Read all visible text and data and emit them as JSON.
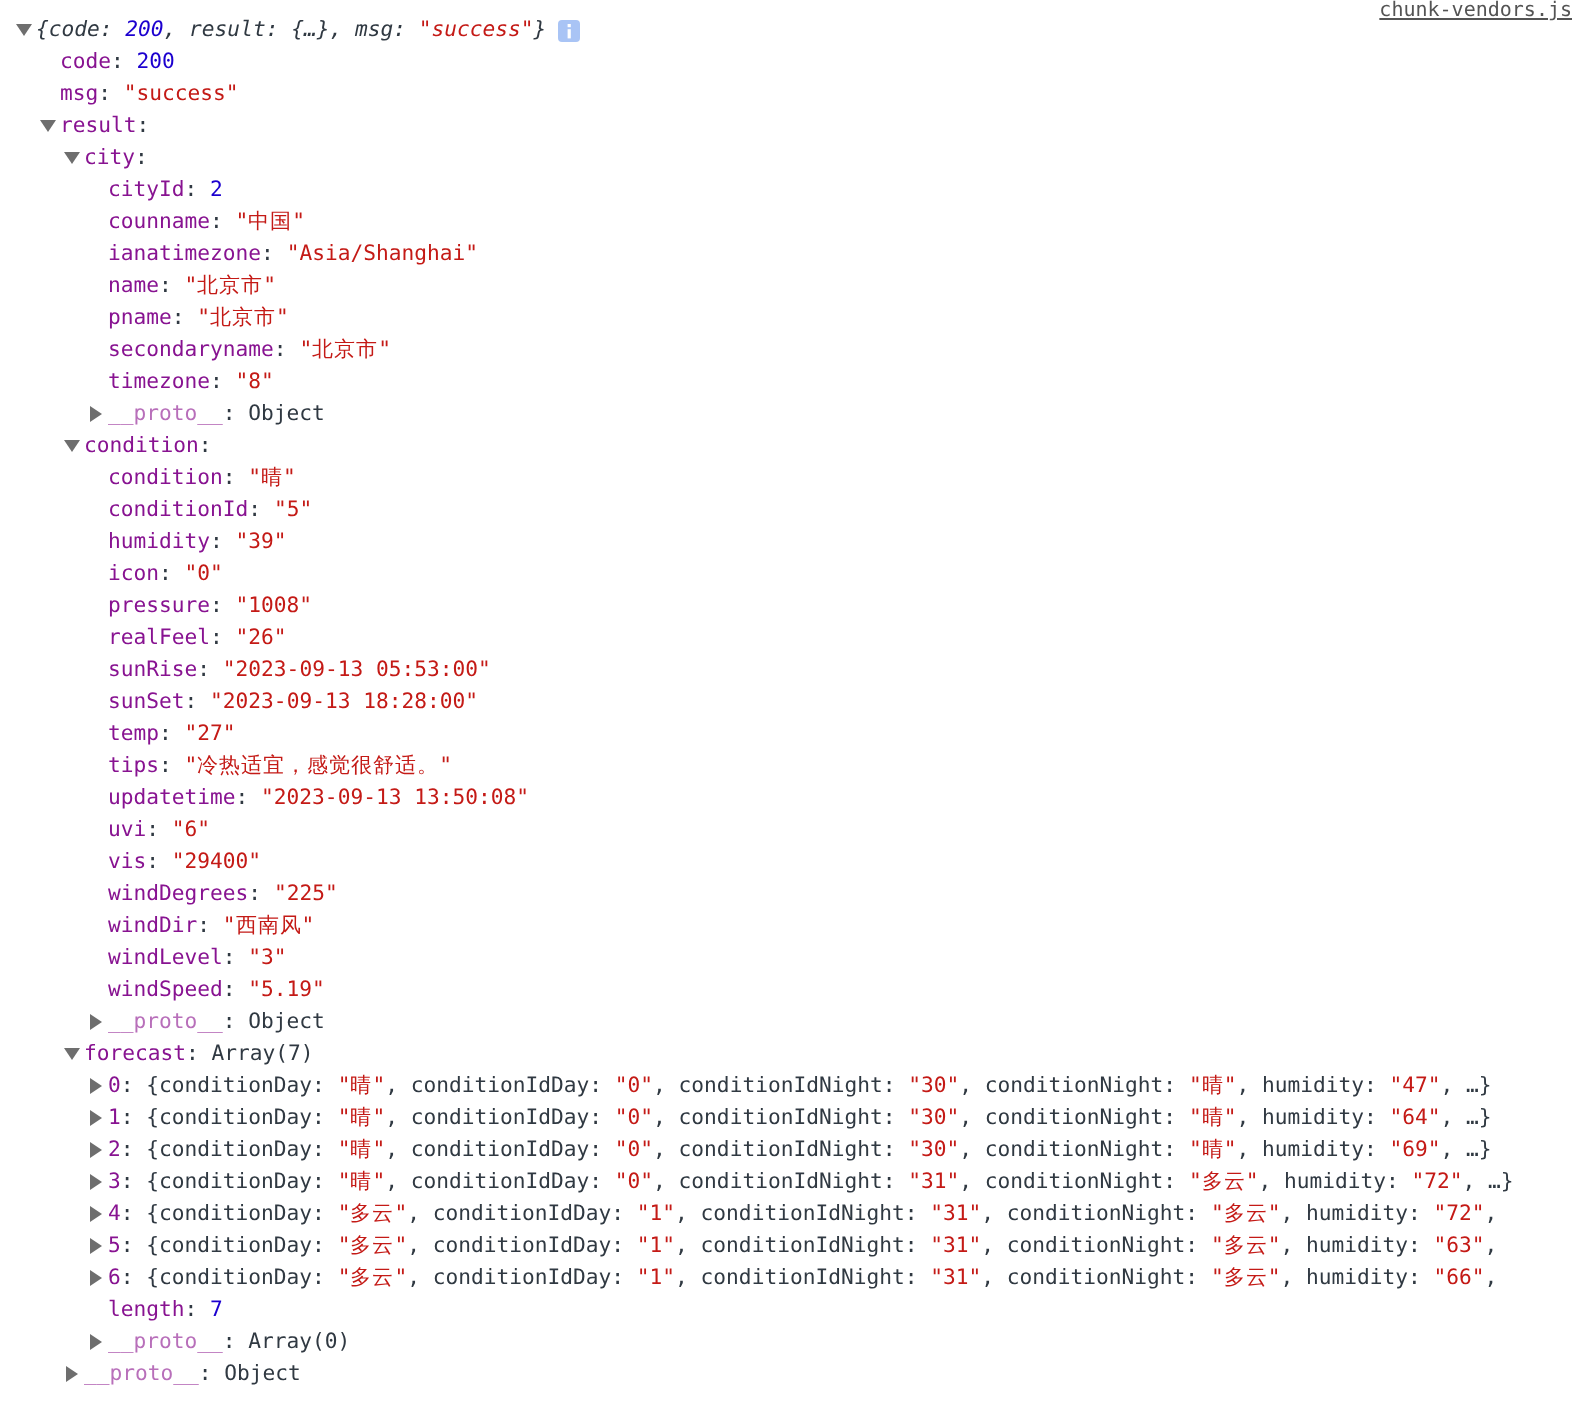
{
  "source_link": "chunk-vendors.js",
  "tree": {
    "kind": "summary",
    "expanded": true,
    "segments": [
      {
        "text": "{code: ",
        "kind": "plain"
      },
      {
        "text": "200",
        "kind": "number"
      },
      {
        "text": ", result: {…}, msg: ",
        "kind": "plain"
      },
      {
        "text": "\"success\"",
        "kind": "string"
      },
      {
        "text": "}",
        "kind": "plain"
      }
    ],
    "children": [
      {
        "kind": "property",
        "segments": [
          {
            "text": "code",
            "kind": "key"
          },
          {
            "text": ": ",
            "kind": "plain"
          },
          {
            "text": "200",
            "kind": "number"
          }
        ]
      },
      {
        "kind": "property",
        "segments": [
          {
            "text": "msg",
            "kind": "key"
          },
          {
            "text": ": ",
            "kind": "plain"
          },
          {
            "text": "\"success\"",
            "kind": "string"
          }
        ]
      },
      {
        "kind": "property",
        "expanded": true,
        "segments": [
          {
            "text": "result",
            "kind": "key"
          },
          {
            "text": ":",
            "kind": "plain"
          }
        ],
        "children": [
          {
            "kind": "property",
            "expanded": true,
            "segments": [
              {
                "text": "city",
                "kind": "key"
              },
              {
                "text": ":",
                "kind": "plain"
              }
            ],
            "children": [
              {
                "kind": "property",
                "segments": [
                  {
                    "text": "cityId",
                    "kind": "key"
                  },
                  {
                    "text": ": ",
                    "kind": "plain"
                  },
                  {
                    "text": "2",
                    "kind": "number"
                  }
                ]
              },
              {
                "kind": "property",
                "segments": [
                  {
                    "text": "counname",
                    "kind": "key"
                  },
                  {
                    "text": ": ",
                    "kind": "plain"
                  },
                  {
                    "text": "\"中国\"",
                    "kind": "string"
                  }
                ]
              },
              {
                "kind": "property",
                "segments": [
                  {
                    "text": "ianatimezone",
                    "kind": "key"
                  },
                  {
                    "text": ": ",
                    "kind": "plain"
                  },
                  {
                    "text": "\"Asia/Shanghai\"",
                    "kind": "string"
                  }
                ]
              },
              {
                "kind": "property",
                "segments": [
                  {
                    "text": "name",
                    "kind": "key"
                  },
                  {
                    "text": ": ",
                    "kind": "plain"
                  },
                  {
                    "text": "\"北京市\"",
                    "kind": "string"
                  }
                ]
              },
              {
                "kind": "property",
                "segments": [
                  {
                    "text": "pname",
                    "kind": "key"
                  },
                  {
                    "text": ": ",
                    "kind": "plain"
                  },
                  {
                    "text": "\"北京市\"",
                    "kind": "string"
                  }
                ]
              },
              {
                "kind": "property",
                "segments": [
                  {
                    "text": "secondaryname",
                    "kind": "key"
                  },
                  {
                    "text": ": ",
                    "kind": "plain"
                  },
                  {
                    "text": "\"北京市\"",
                    "kind": "string"
                  }
                ]
              },
              {
                "kind": "property",
                "segments": [
                  {
                    "text": "timezone",
                    "kind": "key"
                  },
                  {
                    "text": ": ",
                    "kind": "plain"
                  },
                  {
                    "text": "\"8\"",
                    "kind": "string"
                  }
                ]
              },
              {
                "kind": "property",
                "expanded": false,
                "segments": [
                  {
                    "text": "__proto__",
                    "kind": "proto"
                  },
                  {
                    "text": ": Object",
                    "kind": "plain"
                  }
                ]
              }
            ]
          },
          {
            "kind": "property",
            "expanded": true,
            "segments": [
              {
                "text": "condition",
                "kind": "key"
              },
              {
                "text": ":",
                "kind": "plain"
              }
            ],
            "children": [
              {
                "kind": "property",
                "segments": [
                  {
                    "text": "condition",
                    "kind": "key"
                  },
                  {
                    "text": ": ",
                    "kind": "plain"
                  },
                  {
                    "text": "\"晴\"",
                    "kind": "string"
                  }
                ]
              },
              {
                "kind": "property",
                "segments": [
                  {
                    "text": "conditionId",
                    "kind": "key"
                  },
                  {
                    "text": ": ",
                    "kind": "plain"
                  },
                  {
                    "text": "\"5\"",
                    "kind": "string"
                  }
                ]
              },
              {
                "kind": "property",
                "segments": [
                  {
                    "text": "humidity",
                    "kind": "key"
                  },
                  {
                    "text": ": ",
                    "kind": "plain"
                  },
                  {
                    "text": "\"39\"",
                    "kind": "string"
                  }
                ]
              },
              {
                "kind": "property",
                "segments": [
                  {
                    "text": "icon",
                    "kind": "key"
                  },
                  {
                    "text": ": ",
                    "kind": "plain"
                  },
                  {
                    "text": "\"0\"",
                    "kind": "string"
                  }
                ]
              },
              {
                "kind": "property",
                "segments": [
                  {
                    "text": "pressure",
                    "kind": "key"
                  },
                  {
                    "text": ": ",
                    "kind": "plain"
                  },
                  {
                    "text": "\"1008\"",
                    "kind": "string"
                  }
                ]
              },
              {
                "kind": "property",
                "segments": [
                  {
                    "text": "realFeel",
                    "kind": "key"
                  },
                  {
                    "text": ": ",
                    "kind": "plain"
                  },
                  {
                    "text": "\"26\"",
                    "kind": "string"
                  }
                ]
              },
              {
                "kind": "property",
                "segments": [
                  {
                    "text": "sunRise",
                    "kind": "key"
                  },
                  {
                    "text": ": ",
                    "kind": "plain"
                  },
                  {
                    "text": "\"2023-09-13 05:53:00\"",
                    "kind": "string"
                  }
                ]
              },
              {
                "kind": "property",
                "segments": [
                  {
                    "text": "sunSet",
                    "kind": "key"
                  },
                  {
                    "text": ": ",
                    "kind": "plain"
                  },
                  {
                    "text": "\"2023-09-13 18:28:00\"",
                    "kind": "string"
                  }
                ]
              },
              {
                "kind": "property",
                "segments": [
                  {
                    "text": "temp",
                    "kind": "key"
                  },
                  {
                    "text": ": ",
                    "kind": "plain"
                  },
                  {
                    "text": "\"27\"",
                    "kind": "string"
                  }
                ]
              },
              {
                "kind": "property",
                "segments": [
                  {
                    "text": "tips",
                    "kind": "key"
                  },
                  {
                    "text": ": ",
                    "kind": "plain"
                  },
                  {
                    "text": "\"冷热适宜，感觉很舒适。\"",
                    "kind": "string"
                  }
                ]
              },
              {
                "kind": "property",
                "segments": [
                  {
                    "text": "updatetime",
                    "kind": "key"
                  },
                  {
                    "text": ": ",
                    "kind": "plain"
                  },
                  {
                    "text": "\"2023-09-13 13:50:08\"",
                    "kind": "string"
                  }
                ]
              },
              {
                "kind": "property",
                "segments": [
                  {
                    "text": "uvi",
                    "kind": "key"
                  },
                  {
                    "text": ": ",
                    "kind": "plain"
                  },
                  {
                    "text": "\"6\"",
                    "kind": "string"
                  }
                ]
              },
              {
                "kind": "property",
                "segments": [
                  {
                    "text": "vis",
                    "kind": "key"
                  },
                  {
                    "text": ": ",
                    "kind": "plain"
                  },
                  {
                    "text": "\"29400\"",
                    "kind": "string"
                  }
                ]
              },
              {
                "kind": "property",
                "segments": [
                  {
                    "text": "windDegrees",
                    "kind": "key"
                  },
                  {
                    "text": ": ",
                    "kind": "plain"
                  },
                  {
                    "text": "\"225\"",
                    "kind": "string"
                  }
                ]
              },
              {
                "kind": "property",
                "segments": [
                  {
                    "text": "windDir",
                    "kind": "key"
                  },
                  {
                    "text": ": ",
                    "kind": "plain"
                  },
                  {
                    "text": "\"西南风\"",
                    "kind": "string"
                  }
                ]
              },
              {
                "kind": "property",
                "segments": [
                  {
                    "text": "windLevel",
                    "kind": "key"
                  },
                  {
                    "text": ": ",
                    "kind": "plain"
                  },
                  {
                    "text": "\"3\"",
                    "kind": "string"
                  }
                ]
              },
              {
                "kind": "property",
                "segments": [
                  {
                    "text": "windSpeed",
                    "kind": "key"
                  },
                  {
                    "text": ": ",
                    "kind": "plain"
                  },
                  {
                    "text": "\"5.19\"",
                    "kind": "string"
                  }
                ]
              },
              {
                "kind": "property",
                "expanded": false,
                "segments": [
                  {
                    "text": "__proto__",
                    "kind": "proto"
                  },
                  {
                    "text": ": Object",
                    "kind": "plain"
                  }
                ]
              }
            ]
          },
          {
            "kind": "property",
            "expanded": true,
            "segments": [
              {
                "text": "forecast",
                "kind": "key"
              },
              {
                "text": ": Array(7)",
                "kind": "plain"
              }
            ],
            "children": [
              {
                "kind": "property",
                "expanded": false,
                "segments": [
                  {
                    "text": "0",
                    "kind": "key"
                  },
                  {
                    "text": ": {conditionDay: ",
                    "kind": "plain"
                  },
                  {
                    "text": "\"晴\"",
                    "kind": "string"
                  },
                  {
                    "text": ", conditionIdDay: ",
                    "kind": "plain"
                  },
                  {
                    "text": "\"0\"",
                    "kind": "string"
                  },
                  {
                    "text": ", conditionIdNight: ",
                    "kind": "plain"
                  },
                  {
                    "text": "\"30\"",
                    "kind": "string"
                  },
                  {
                    "text": ", conditionNight: ",
                    "kind": "plain"
                  },
                  {
                    "text": "\"晴\"",
                    "kind": "string"
                  },
                  {
                    "text": ", humidity: ",
                    "kind": "plain"
                  },
                  {
                    "text": "\"47\"",
                    "kind": "string"
                  },
                  {
                    "text": ", …}",
                    "kind": "plain"
                  }
                ]
              },
              {
                "kind": "property",
                "expanded": false,
                "segments": [
                  {
                    "text": "1",
                    "kind": "key"
                  },
                  {
                    "text": ": {conditionDay: ",
                    "kind": "plain"
                  },
                  {
                    "text": "\"晴\"",
                    "kind": "string"
                  },
                  {
                    "text": ", conditionIdDay: ",
                    "kind": "plain"
                  },
                  {
                    "text": "\"0\"",
                    "kind": "string"
                  },
                  {
                    "text": ", conditionIdNight: ",
                    "kind": "plain"
                  },
                  {
                    "text": "\"30\"",
                    "kind": "string"
                  },
                  {
                    "text": ", conditionNight: ",
                    "kind": "plain"
                  },
                  {
                    "text": "\"晴\"",
                    "kind": "string"
                  },
                  {
                    "text": ", humidity: ",
                    "kind": "plain"
                  },
                  {
                    "text": "\"64\"",
                    "kind": "string"
                  },
                  {
                    "text": ", …}",
                    "kind": "plain"
                  }
                ]
              },
              {
                "kind": "property",
                "expanded": false,
                "segments": [
                  {
                    "text": "2",
                    "kind": "key"
                  },
                  {
                    "text": ": {conditionDay: ",
                    "kind": "plain"
                  },
                  {
                    "text": "\"晴\"",
                    "kind": "string"
                  },
                  {
                    "text": ", conditionIdDay: ",
                    "kind": "plain"
                  },
                  {
                    "text": "\"0\"",
                    "kind": "string"
                  },
                  {
                    "text": ", conditionIdNight: ",
                    "kind": "plain"
                  },
                  {
                    "text": "\"30\"",
                    "kind": "string"
                  },
                  {
                    "text": ", conditionNight: ",
                    "kind": "plain"
                  },
                  {
                    "text": "\"晴\"",
                    "kind": "string"
                  },
                  {
                    "text": ", humidity: ",
                    "kind": "plain"
                  },
                  {
                    "text": "\"69\"",
                    "kind": "string"
                  },
                  {
                    "text": ", …}",
                    "kind": "plain"
                  }
                ]
              },
              {
                "kind": "property",
                "expanded": false,
                "segments": [
                  {
                    "text": "3",
                    "kind": "key"
                  },
                  {
                    "text": ": {conditionDay: ",
                    "kind": "plain"
                  },
                  {
                    "text": "\"晴\"",
                    "kind": "string"
                  },
                  {
                    "text": ", conditionIdDay: ",
                    "kind": "plain"
                  },
                  {
                    "text": "\"0\"",
                    "kind": "string"
                  },
                  {
                    "text": ", conditionIdNight: ",
                    "kind": "plain"
                  },
                  {
                    "text": "\"31\"",
                    "kind": "string"
                  },
                  {
                    "text": ", conditionNight: ",
                    "kind": "plain"
                  },
                  {
                    "text": "\"多云\"",
                    "kind": "string"
                  },
                  {
                    "text": ", humidity: ",
                    "kind": "plain"
                  },
                  {
                    "text": "\"72\"",
                    "kind": "string"
                  },
                  {
                    "text": ", …}",
                    "kind": "plain"
                  }
                ]
              },
              {
                "kind": "property",
                "expanded": false,
                "segments": [
                  {
                    "text": "4",
                    "kind": "key"
                  },
                  {
                    "text": ": {conditionDay: ",
                    "kind": "plain"
                  },
                  {
                    "text": "\"多云\"",
                    "kind": "string"
                  },
                  {
                    "text": ", conditionIdDay: ",
                    "kind": "plain"
                  },
                  {
                    "text": "\"1\"",
                    "kind": "string"
                  },
                  {
                    "text": ", conditionIdNight: ",
                    "kind": "plain"
                  },
                  {
                    "text": "\"31\"",
                    "kind": "string"
                  },
                  {
                    "text": ", conditionNight: ",
                    "kind": "plain"
                  },
                  {
                    "text": "\"多云\"",
                    "kind": "string"
                  },
                  {
                    "text": ", humidity: ",
                    "kind": "plain"
                  },
                  {
                    "text": "\"72\"",
                    "kind": "string"
                  },
                  {
                    "text": ",",
                    "kind": "plain"
                  }
                ]
              },
              {
                "kind": "property",
                "expanded": false,
                "segments": [
                  {
                    "text": "5",
                    "kind": "key"
                  },
                  {
                    "text": ": {conditionDay: ",
                    "kind": "plain"
                  },
                  {
                    "text": "\"多云\"",
                    "kind": "string"
                  },
                  {
                    "text": ", conditionIdDay: ",
                    "kind": "plain"
                  },
                  {
                    "text": "\"1\"",
                    "kind": "string"
                  },
                  {
                    "text": ", conditionIdNight: ",
                    "kind": "plain"
                  },
                  {
                    "text": "\"31\"",
                    "kind": "string"
                  },
                  {
                    "text": ", conditionNight: ",
                    "kind": "plain"
                  },
                  {
                    "text": "\"多云\"",
                    "kind": "string"
                  },
                  {
                    "text": ", humidity: ",
                    "kind": "plain"
                  },
                  {
                    "text": "\"63\"",
                    "kind": "string"
                  },
                  {
                    "text": ",",
                    "kind": "plain"
                  }
                ]
              },
              {
                "kind": "property",
                "expanded": false,
                "segments": [
                  {
                    "text": "6",
                    "kind": "key"
                  },
                  {
                    "text": ": {conditionDay: ",
                    "kind": "plain"
                  },
                  {
                    "text": "\"多云\"",
                    "kind": "string"
                  },
                  {
                    "text": ", conditionIdDay: ",
                    "kind": "plain"
                  },
                  {
                    "text": "\"1\"",
                    "kind": "string"
                  },
                  {
                    "text": ", conditionIdNight: ",
                    "kind": "plain"
                  },
                  {
                    "text": "\"31\"",
                    "kind": "string"
                  },
                  {
                    "text": ", conditionNight: ",
                    "kind": "plain"
                  },
                  {
                    "text": "\"多云\"",
                    "kind": "string"
                  },
                  {
                    "text": ", humidity: ",
                    "kind": "plain"
                  },
                  {
                    "text": "\"66\"",
                    "kind": "string"
                  },
                  {
                    "text": ",",
                    "kind": "plain"
                  }
                ]
              },
              {
                "kind": "property",
                "segments": [
                  {
                    "text": "length",
                    "kind": "key"
                  },
                  {
                    "text": ": ",
                    "kind": "plain"
                  },
                  {
                    "text": "7",
                    "kind": "number"
                  }
                ]
              },
              {
                "kind": "property",
                "expanded": false,
                "segments": [
                  {
                    "text": "__proto__",
                    "kind": "proto"
                  },
                  {
                    "text": ": Array(0)",
                    "kind": "plain"
                  }
                ]
              }
            ]
          },
          {
            "kind": "property",
            "expanded": false,
            "segments": [
              {
                "text": "__proto__",
                "kind": "proto"
              },
              {
                "text": ": Object",
                "kind": "plain"
              }
            ]
          }
        ]
      }
    ]
  }
}
